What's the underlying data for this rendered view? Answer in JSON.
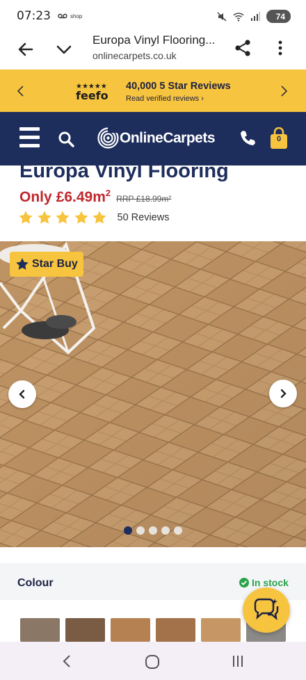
{
  "status_bar": {
    "time": "07:23",
    "notification_label": "shop",
    "battery": "74"
  },
  "browser": {
    "title": "Europa Vinyl Flooring...",
    "url": "onlinecarpets.co.uk"
  },
  "banner": {
    "brand": "feefo",
    "headline": "40,000 5 Star Reviews",
    "link": "Read verified reviews ›"
  },
  "header": {
    "logo_text": "OnlineCarpets",
    "basket_count": "0"
  },
  "product": {
    "title": "Europa Vinyl Flooring",
    "price_prefix": "Only",
    "price": "£6.49m",
    "price_unit": "2",
    "rrp": "RRP £18.99m²",
    "rating": 5,
    "reviews_count": "50 Reviews",
    "badge": "Star Buy"
  },
  "carousel": {
    "slide_count": 5,
    "active_index": 0
  },
  "colour": {
    "label": "Colour",
    "stock_status": "In stock",
    "swatches": [
      {
        "color": "#8a7766"
      },
      {
        "color": "#7a5c45"
      },
      {
        "color": "#b58152"
      },
      {
        "color": "#a3724a"
      },
      {
        "color": "#c69765"
      },
      {
        "color": "#8b8a87"
      }
    ]
  },
  "colors": {
    "navy": "#1d2d5c",
    "yellow": "#f7c43f",
    "price_red": "#c1272d",
    "stock_green": "#2ba34a"
  }
}
